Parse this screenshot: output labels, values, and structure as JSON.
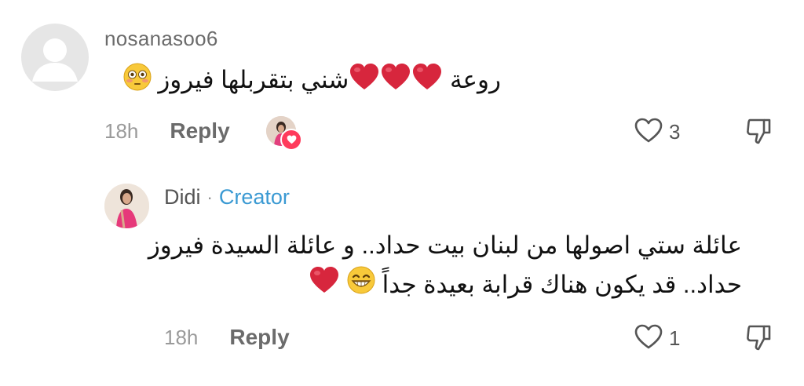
{
  "comment": {
    "username": "nosanasoo6",
    "text": "روعة ❤️❤️❤️شني بتقربلها فيروز 😳",
    "text_parts": {
      "prefix": "روعة ",
      "suffix": "شني بتقربلها فيروز "
    },
    "heart_emoji_count": 3,
    "timestamp": "18h",
    "reply_label": "Reply",
    "like_count": "3",
    "icons": [
      "default-avatar-icon",
      "heart-outline-icon",
      "dislike-icon",
      "flushed-face-emoji",
      "red-heart-emoji"
    ]
  },
  "reply": {
    "username": "Didi",
    "separator": "·",
    "badge": "Creator",
    "line1": "عائلة ستي اصولها من لبنان بيت حداد.. و عائلة السيدة فيروز",
    "line2_text": "حداد.. قد يكون هناك قرابة بعيدة جداً ",
    "timestamp": "18h",
    "reply_label": "Reply",
    "like_count": "1",
    "icons": [
      "heart-outline-icon",
      "dislike-icon",
      "grinning-face-emoji",
      "red-heart-emoji"
    ]
  },
  "colors": {
    "creator": "#3b9ad3",
    "heart": "#d7263d",
    "muted": "#9a9a9a",
    "username": "#6b6b6b"
  }
}
